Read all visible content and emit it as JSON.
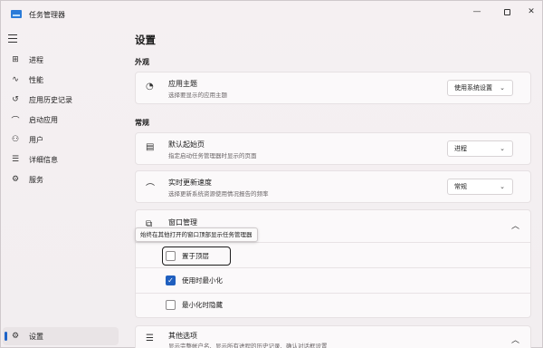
{
  "window": {
    "title": "任务管理器"
  },
  "sidebar": {
    "items": [
      {
        "label": "进程",
        "icon": "processes-icon"
      },
      {
        "label": "性能",
        "icon": "performance-icon"
      },
      {
        "label": "应用历史记录",
        "icon": "history-icon"
      },
      {
        "label": "启动应用",
        "icon": "startup-icon"
      },
      {
        "label": "用户",
        "icon": "users-icon"
      },
      {
        "label": "详细信息",
        "icon": "details-icon"
      },
      {
        "label": "服务",
        "icon": "services-icon"
      }
    ],
    "settings": {
      "label": "设置",
      "icon": "gear-icon",
      "active": true
    }
  },
  "main": {
    "title": "设置",
    "sections": {
      "appearance": "外观",
      "general": "常规"
    },
    "theme": {
      "title": "应用主题",
      "desc": "选择要显示的应用主题",
      "value": "使用系统设置"
    },
    "start_page": {
      "title": "默认起始页",
      "desc": "指定启动任务管理器时显示的页面",
      "value": "进程"
    },
    "update_speed": {
      "title": "实时更新速度",
      "desc": "选择更新系统资源使用情况报告的频率",
      "value": "常规"
    },
    "window_mgmt": {
      "title": "窗口管理",
      "tooltip": "始终在其他打开的窗口顶部显示任务管理器",
      "options": [
        {
          "label": "置于顶层",
          "checked": false
        },
        {
          "label": "使用时最小化",
          "checked": true
        },
        {
          "label": "最小化时隐藏",
          "checked": false
        }
      ]
    },
    "other": {
      "title": "其他选项",
      "desc": "显示完整帐户名、显示所有进程的历史记录、确认对话框设置"
    }
  },
  "colors": {
    "accent": "#1f5fbf",
    "background": "#f3eef0",
    "card": "#fbf9fa"
  }
}
